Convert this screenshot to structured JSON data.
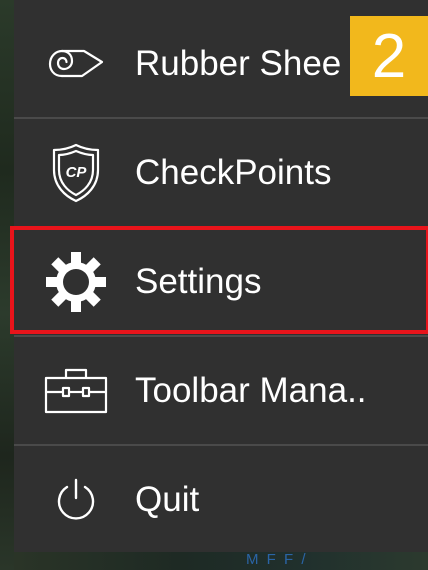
{
  "menu": {
    "items": [
      {
        "label": "Rubber Shee",
        "icon": "rubber-sheet-icon"
      },
      {
        "label": "CheckPoints",
        "icon": "checkpoints-shield-icon"
      },
      {
        "label": "Settings",
        "icon": "gear-icon"
      },
      {
        "label": "Toolbar Mana..",
        "icon": "toolbox-icon"
      },
      {
        "label": "Quit",
        "icon": "power-icon"
      }
    ],
    "highlighted_item": "Settings"
  },
  "step_badge": {
    "text": "2"
  },
  "colors": {
    "menu_background": "#303030",
    "highlight_border": "#e8141b",
    "badge_background": "#f2b81c",
    "text": "#ffffff"
  }
}
